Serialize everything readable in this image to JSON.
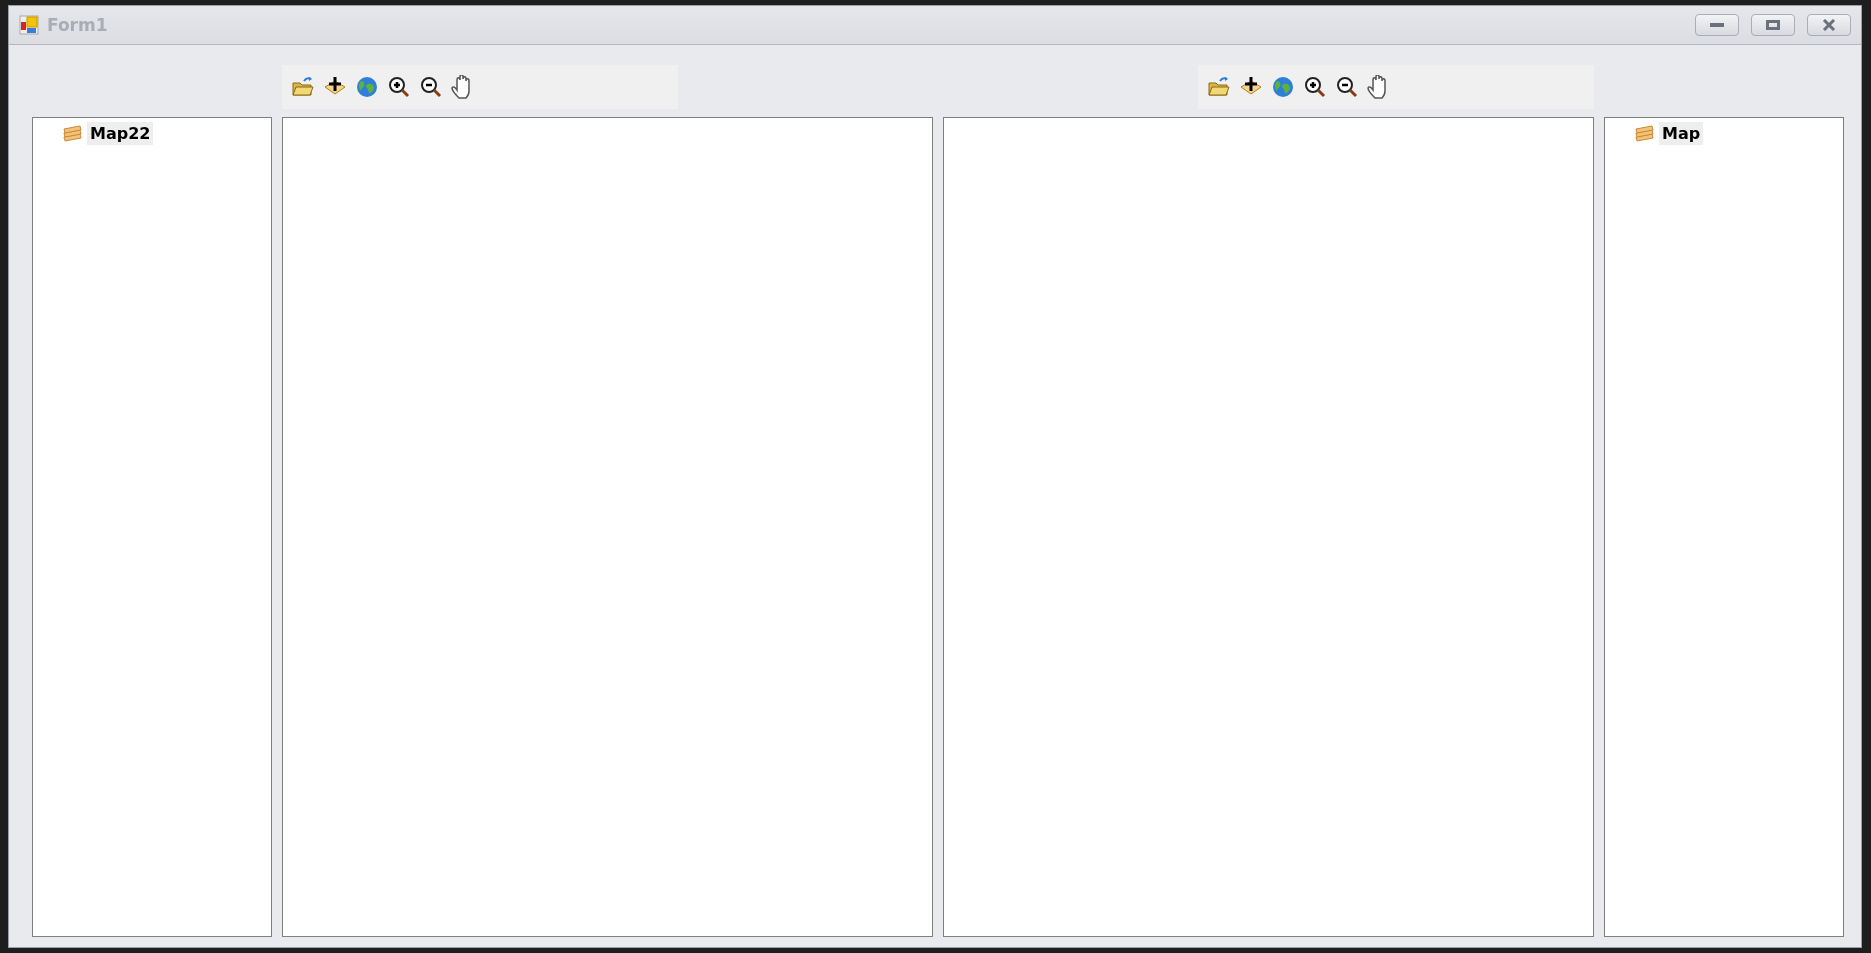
{
  "window": {
    "title": "Form1"
  },
  "left_tree": {
    "items": [
      {
        "label": "Map22",
        "selected": true
      }
    ]
  },
  "right_tree": {
    "items": [
      {
        "label": "Map",
        "selected": true
      }
    ]
  }
}
